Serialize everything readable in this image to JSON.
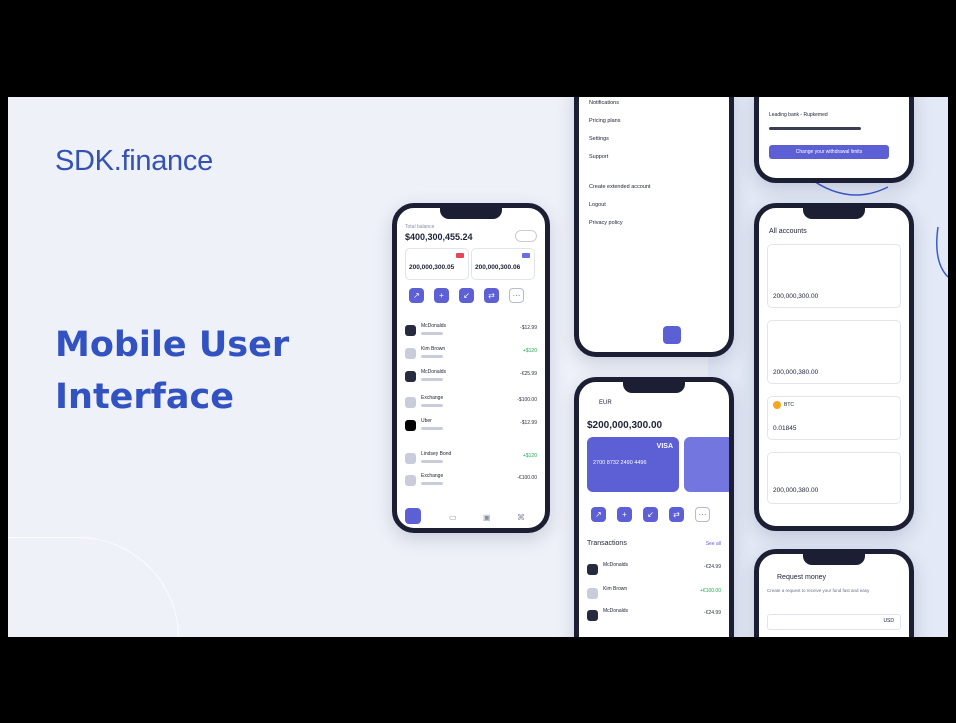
{
  "brand": {
    "name": "SDK.finance"
  },
  "headline": {
    "line1": "Mobile User",
    "line2": "Interface"
  },
  "phone_home": {
    "total_balance": "$400,300,455.24",
    "usd_account_value": "200,000,300.05",
    "eur_account_value": "200,000,300.06",
    "transactions": [
      {
        "name": "McDonalds",
        "amount": "-$12.99",
        "positive": false
      },
      {
        "name": "Kim Brown",
        "amount": "+$120",
        "positive": true
      },
      {
        "name": "McDonalds",
        "amount": "-€25.99",
        "positive": false
      },
      {
        "name": "Exchange",
        "amount": "-$100.00",
        "positive": false
      },
      {
        "name": "Uber",
        "amount": "-$12.99",
        "positive": false
      },
      {
        "name": "Lindsey Bond",
        "amount": "+$120",
        "positive": true
      },
      {
        "name": "Exchange",
        "amount": "-€100.00",
        "positive": false
      }
    ]
  },
  "phone_menu": {
    "items": [
      "Notifications",
      "Pricing plans",
      "Settings",
      "Support",
      "Create extended account",
      "Logout",
      "Privacy policy"
    ]
  },
  "phone_card": {
    "currency": "EUR",
    "balance": "$200,000,300.00",
    "card_brand": "VISA",
    "card_number": "2700 8732 2490 4496",
    "section_title": "Transactions",
    "see_all": "See all",
    "transactions": [
      {
        "name": "McDonalds",
        "amount": "-€24.99",
        "positive": false
      },
      {
        "name": "Kim Brown",
        "amount": "+€100.00",
        "positive": true
      },
      {
        "name": "McDonalds",
        "amount": "-€24.99",
        "positive": false
      }
    ]
  },
  "phone_withdraw": {
    "label": "Leading bank - Rupkemed",
    "button": "Change your withdrawal limits"
  },
  "phone_accounts": {
    "title": "All accounts",
    "balances": [
      "200,000,300.00",
      "200,000,380.00",
      "0.01845",
      "200,000,380.00"
    ],
    "crypto_code": "BTC"
  },
  "phone_request": {
    "title": "Request money",
    "subtitle": "Create a request to receive your fund fast and easy",
    "currency": "USD"
  },
  "colors": {
    "accent": "#5d5fd4",
    "brand": "#3252c2",
    "background": "#eef1f8",
    "frame": "#1c1f33"
  }
}
